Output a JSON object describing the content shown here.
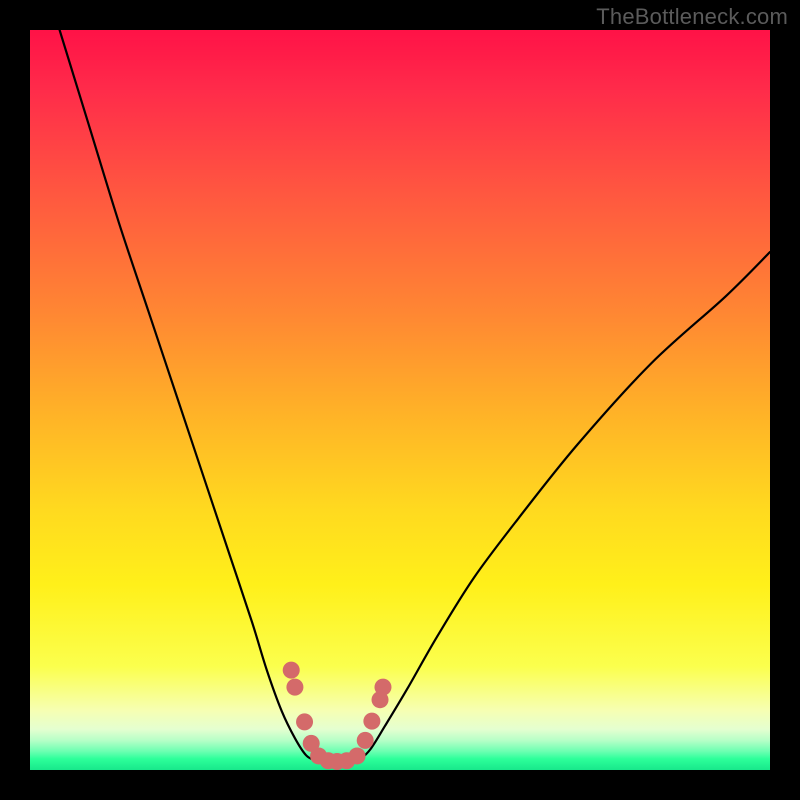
{
  "watermark": "TheBottleneck.com",
  "chart_data": {
    "type": "line",
    "title": "",
    "xlabel": "",
    "ylabel": "",
    "xlim": [
      0,
      100
    ],
    "ylim": [
      0,
      100
    ],
    "grid": false,
    "legend": false,
    "series": [
      {
        "name": "left-curve",
        "x": [
          4,
          8,
          12,
          16,
          20,
          24,
          27,
          30,
          32,
          34,
          35.8,
          37.3,
          38.5
        ],
        "y": [
          100,
          87,
          74,
          62,
          50,
          38,
          29,
          20,
          13.5,
          8,
          4.3,
          2,
          1.3
        ]
      },
      {
        "name": "right-curve",
        "x": [
          44.5,
          46,
          48,
          51,
          55,
          60,
          66,
          74,
          84,
          94,
          100
        ],
        "y": [
          1.3,
          2.8,
          6,
          11,
          18,
          26,
          34,
          44,
          55,
          64,
          70
        ]
      },
      {
        "name": "valley-floor",
        "x": [
          38.5,
          40,
          41.5,
          43,
          44.5
        ],
        "y": [
          1.3,
          1.1,
          1.05,
          1.1,
          1.3
        ]
      }
    ],
    "markers": {
      "name": "red-dots",
      "color": "#d46a6a",
      "points_xy": [
        [
          35.3,
          13.5
        ],
        [
          35.8,
          11.2
        ],
        [
          37.1,
          6.5
        ],
        [
          38.0,
          3.6
        ],
        [
          39.0,
          1.9
        ],
        [
          40.3,
          1.25
        ],
        [
          41.5,
          1.15
        ],
        [
          42.8,
          1.25
        ],
        [
          44.2,
          1.9
        ],
        [
          45.3,
          4.0
        ],
        [
          46.2,
          6.6
        ],
        [
          47.3,
          9.5
        ],
        [
          47.7,
          11.2
        ]
      ]
    },
    "colors": {
      "curve": "#000000",
      "marker_fill": "#d46a6a"
    }
  }
}
